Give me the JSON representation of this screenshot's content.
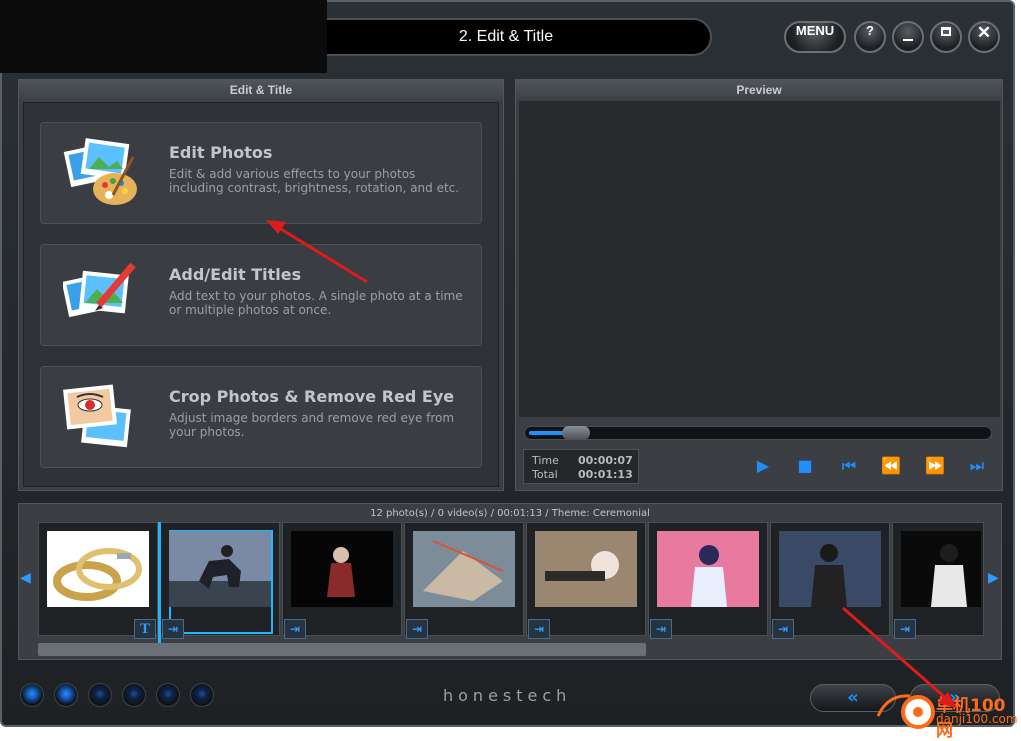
{
  "app": {
    "title": "2. Edit & Title",
    "menu_label": "MENU",
    "help_label": "?",
    "brand": "honestech"
  },
  "left_panel": {
    "header": "Edit & Title",
    "options": [
      {
        "title": "Edit Photos",
        "desc": "Edit & add various effects to your photos including contrast, brightness, rotation, and etc.",
        "icon": "photo-palette-icon"
      },
      {
        "title": "Add/Edit Titles",
        "desc": "Add text to your photos.  A single photo at a time or multiple photos at once.",
        "icon": "photo-pencil-icon"
      },
      {
        "title": "Crop Photos & Remove Red Eye",
        "desc": "Adjust image borders and remove red eye from your photos.",
        "icon": "red-eye-photo-icon"
      }
    ]
  },
  "preview": {
    "header": "Preview",
    "time_label": "Time",
    "time_value": "00:00:07",
    "total_label": "Total",
    "total_value": "00:01:13",
    "progress": 0.08
  },
  "strip": {
    "info": "12 photo(s) / 0 video(s) / 00:01:13 / Theme: Ceremonial",
    "thumbnails": [
      {
        "name": "wedding-rings"
      },
      {
        "name": "rider-on-horse",
        "selected": true
      },
      {
        "name": "character-dark"
      },
      {
        "name": "mech-battle"
      },
      {
        "name": "gunner-girl"
      },
      {
        "name": "pink-girl"
      },
      {
        "name": "girl-office"
      },
      {
        "name": "girl-standing"
      }
    ]
  },
  "watermark": {
    "line1": "单机100网",
    "line2": "danji100.com"
  },
  "colors": {
    "accent": "#1e8fff",
    "annotation": "#e01b1b",
    "watermark": "#ff6a1a"
  }
}
